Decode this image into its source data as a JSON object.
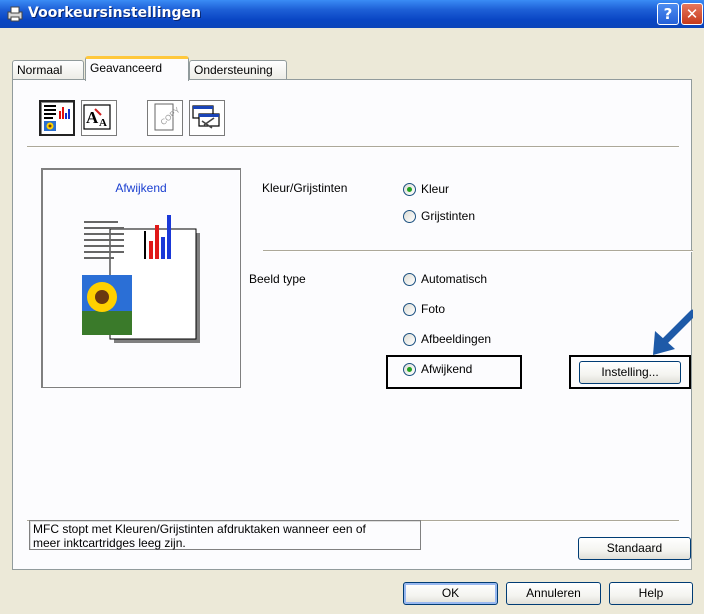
{
  "window": {
    "title": "Voorkeursinstellingen",
    "help_glyph": "?",
    "close_glyph": "✕"
  },
  "tabs": [
    {
      "label": "Normaal",
      "active": false
    },
    {
      "label": "Geavanceerd",
      "active": true
    },
    {
      "label": "Ondersteuning",
      "active": false
    }
  ],
  "toolbar": [
    {
      "icon": "color-settings-icon",
      "selected": true
    },
    {
      "icon": "text-size-icon",
      "selected": false
    },
    {
      "icon": "watermark-copy-icon",
      "selected": false
    },
    {
      "icon": "device-options-icon",
      "selected": false
    }
  ],
  "preview": {
    "caption": "Afwijkend"
  },
  "color_section": {
    "label": "Kleur/Grijstinten",
    "options": [
      {
        "label": "Kleur",
        "checked": true
      },
      {
        "label": "Grijstinten",
        "checked": false
      }
    ]
  },
  "image_type_section": {
    "label": "Beeld type",
    "options": [
      {
        "label": "Automatisch",
        "checked": false
      },
      {
        "label": "Foto",
        "checked": false
      },
      {
        "label": "Afbeeldingen",
        "checked": false
      },
      {
        "label": "Afwijkend",
        "checked": true
      }
    ],
    "settings_button": "Instelling..."
  },
  "status": {
    "line1": "MFC stopt met Kleuren/Grijstinten afdruktaken wanneer een of",
    "line2": "meer inktcartridges leeg zijn."
  },
  "buttons": {
    "default": "Standaard",
    "ok": "OK",
    "cancel": "Annuleren",
    "help": "Help"
  },
  "colors": {
    "title_bar": "#0a46c4",
    "accent_arrow": "#1e5aa8",
    "tab_highlight": "#ffc83c"
  }
}
